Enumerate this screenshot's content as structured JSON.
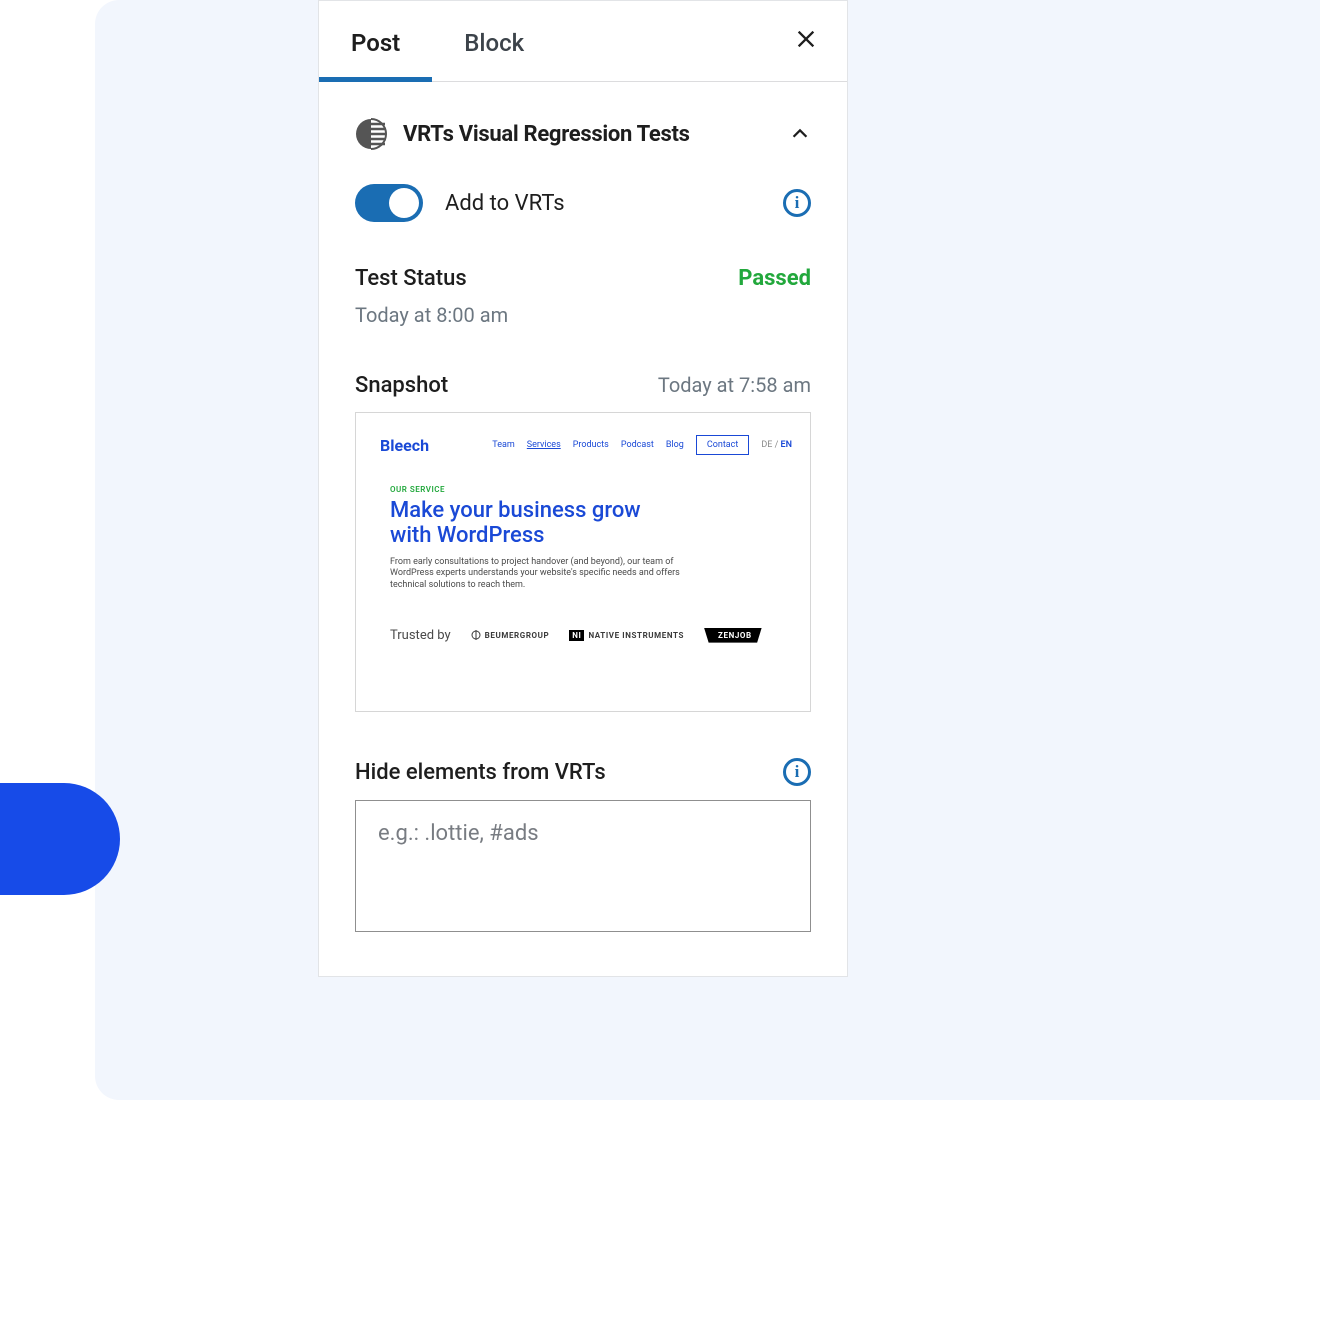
{
  "tabs": {
    "post": "Post",
    "block": "Block"
  },
  "panel": {
    "title": "VRTs Visual Regression Tests",
    "toggle_label": "Add to VRTs"
  },
  "status": {
    "label": "Test Status",
    "value": "Passed",
    "time": "Today at 8:00 am"
  },
  "snapshot": {
    "label": "Snapshot",
    "time": "Today at 7:58 am",
    "logo": "Bleech",
    "nav": {
      "team": "Team",
      "services": "Services",
      "products": "Products",
      "podcast": "Podcast",
      "blog": "Blog",
      "contact": "Contact",
      "lang_de": "DE",
      "lang_en": "EN"
    },
    "overline": "OUR SERVICE",
    "headline": "Make your business grow with WordPress",
    "desc": "From early consultations to project handover (and beyond), our team of WordPress experts understands your website's specific needs and offers technical solutions to reach them.",
    "trusted_label": "Trusted by",
    "brands": {
      "beumer": "BEUMERGROUP",
      "native": "NATIVE INSTRUMENTS",
      "zenjob": "ZENJOB"
    }
  },
  "hide": {
    "label": "Hide elements from VRTs",
    "placeholder": "e.g.: .lottie, #ads"
  },
  "colors": {
    "accent": "#1a6db3",
    "success": "#22a83c",
    "brand_blue": "#174be8"
  }
}
